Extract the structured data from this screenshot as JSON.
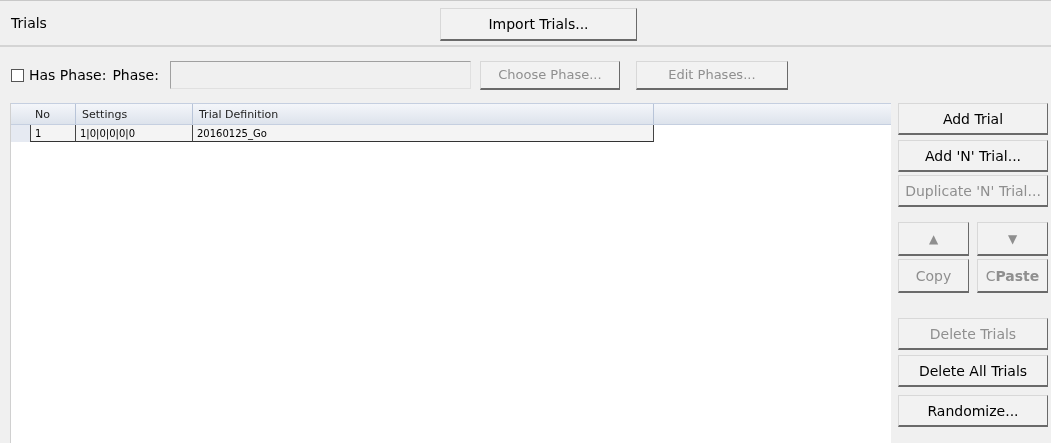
{
  "header": {
    "title": "Trials",
    "import_button": "Import Trials..."
  },
  "phase": {
    "checkbox_label": "Has Phase:",
    "checked": false,
    "field_label": "Phase:",
    "choose_button": {
      "label": "Choose Phase...",
      "disabled": true
    },
    "edit_button": {
      "label": "Edit Phases...",
      "disabled": true
    }
  },
  "table": {
    "columns": [
      "No",
      "Settings",
      "Trial Definition"
    ],
    "rows": [
      {
        "no": "1",
        "settings": "1|0|0|0|0|0",
        "definition": "20160125_Go"
      }
    ]
  },
  "side_buttons": [
    {
      "kind": "wide",
      "label": "Add Trial",
      "disabled": false
    },
    {
      "kind": "wide",
      "label": "Add 'N' Trial...",
      "disabled": false
    },
    {
      "kind": "wide",
      "label": "Duplicate 'N' Trial...",
      "disabled": true
    },
    {
      "kind": "pair",
      "items": [
        {
          "kind": "up",
          "label": "▲",
          "disabled": true
        },
        {
          "kind": "down",
          "label": "▼",
          "disabled": true
        }
      ]
    },
    {
      "kind": "pair",
      "items": [
        {
          "kind": "text",
          "label": "Copy",
          "disabled": true
        },
        {
          "kind": "text",
          "label": "C**Paste**",
          "disabled": true
        }
      ]
    },
    {
      "kind": "wide",
      "label": "Delete Trials",
      "disabled": true
    },
    {
      "kind": "wide",
      "label": "Delete All Trials",
      "disabled": false
    },
    {
      "kind": "wide",
      "label": "Randomize...",
      "disabled": false
    }
  ]
}
